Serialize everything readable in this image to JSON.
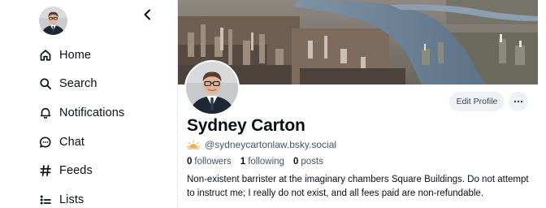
{
  "nav": {
    "items": [
      {
        "label": "Home",
        "icon": "home-icon"
      },
      {
        "label": "Search",
        "icon": "search-icon"
      },
      {
        "label": "Notifications",
        "icon": "bell-icon"
      },
      {
        "label": "Chat",
        "icon": "chat-bubble-icon"
      },
      {
        "label": "Feeds",
        "icon": "hash-icon"
      },
      {
        "label": "Lists",
        "icon": "list-icon"
      }
    ]
  },
  "profile": {
    "display_name": "Sydney Carton",
    "handle": "@sydneycartonlaw.bsky.social",
    "followers_count": "0",
    "followers_label": "followers",
    "following_count": "1",
    "following_label": "following",
    "posts_count": "0",
    "posts_label": "posts",
    "bio": "Non-existent barrister at the imaginary chambers Square Buildings.  Do not attempt to instruct me; I really do not exist, and all fees paid are non-refundable.",
    "edit_label": "Edit Profile"
  },
  "colors": {
    "text": "#0b0f14",
    "muted": "#42576c",
    "button_bg": "#eff2f5"
  }
}
